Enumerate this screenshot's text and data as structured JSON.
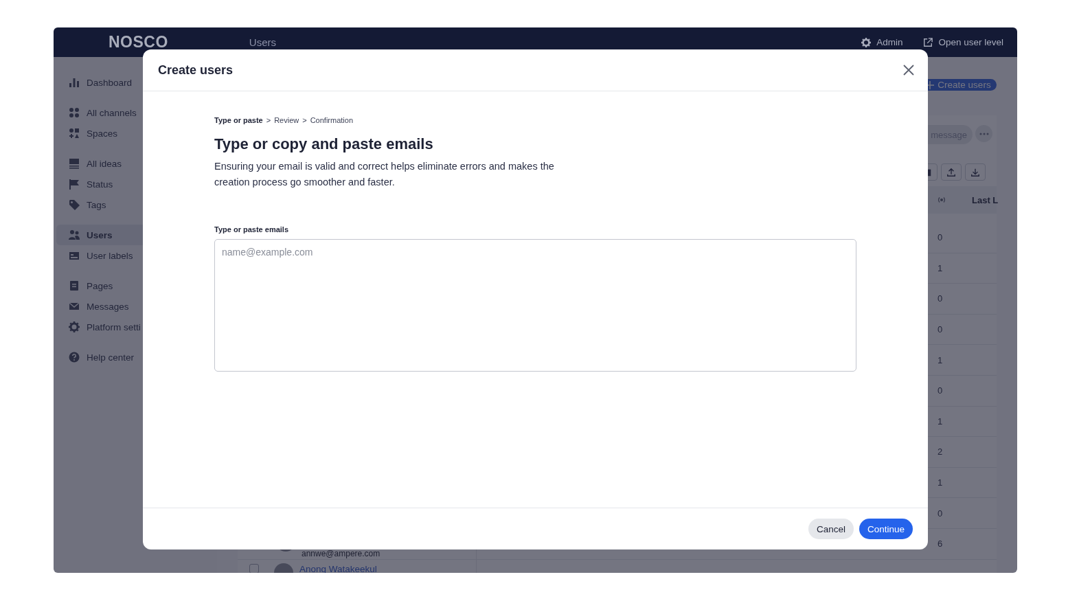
{
  "topbar": {
    "logo": "NOSCO",
    "title": "Users",
    "actions": [
      {
        "label": "Admin",
        "kind": "settings"
      },
      {
        "label": "Open user level",
        "kind": "external"
      }
    ]
  },
  "sidebar": {
    "groups": [
      {
        "items": [
          {
            "label": "Dashboard",
            "kind": "chart",
            "selected": false
          }
        ]
      },
      {
        "items": [
          {
            "label": "All channels",
            "kind": "dots",
            "selected": false
          },
          {
            "label": "Spaces",
            "kind": "spaces",
            "selected": false
          }
        ]
      },
      {
        "items": [
          {
            "label": "All ideas",
            "kind": "list",
            "selected": false
          },
          {
            "label": "Status",
            "kind": "flag",
            "selected": false
          },
          {
            "label": "Tags",
            "kind": "tag",
            "selected": false
          }
        ]
      },
      {
        "items": [
          {
            "label": "Users",
            "kind": "users",
            "selected": true
          },
          {
            "label": "User labels",
            "kind": "label",
            "selected": false
          }
        ]
      },
      {
        "items": [
          {
            "label": "Pages",
            "kind": "page",
            "selected": false
          },
          {
            "label": "Messages",
            "kind": "mail",
            "selected": false
          },
          {
            "label": "Platform setti",
            "kind": "gear",
            "selected": false
          }
        ]
      },
      {
        "items": [
          {
            "label": "Help center",
            "kind": "help",
            "selected": false
          }
        ]
      }
    ]
  },
  "main": {
    "create_button": "Create users",
    "message_button": "message",
    "table": {
      "last_column_header": "Last L",
      "rows": [
        {
          "count": "0"
        },
        {
          "count": "1"
        },
        {
          "count": "0"
        },
        {
          "count": "0"
        },
        {
          "count": "1"
        },
        {
          "count": "0"
        },
        {
          "count": "1"
        },
        {
          "count": "2"
        },
        {
          "count": "1"
        },
        {
          "count": "0"
        },
        {
          "count": "6",
          "email": "annwe@ampere.com"
        },
        {
          "name": "Anong Watakeekul",
          "checked": false
        }
      ]
    }
  },
  "modal": {
    "title": "Create users",
    "breadcrumb": {
      "separators": [
        ">",
        ">"
      ],
      "steps": [
        {
          "label": "Type or paste",
          "selected": true
        },
        {
          "label": "Review",
          "selected": false
        },
        {
          "label": "Confirmation",
          "selected": false
        }
      ]
    },
    "heading": "Type or copy and paste emails",
    "description": "Ensuring your email is valid and correct helps eliminate errors and makes the creation process go smoother and faster.",
    "field": {
      "label": "Type or paste emails",
      "placeholder": "name@example.com"
    },
    "buttons": [
      {
        "label": "Cancel",
        "kind": "secondary"
      },
      {
        "label": "Continue",
        "kind": "primary"
      }
    ]
  }
}
